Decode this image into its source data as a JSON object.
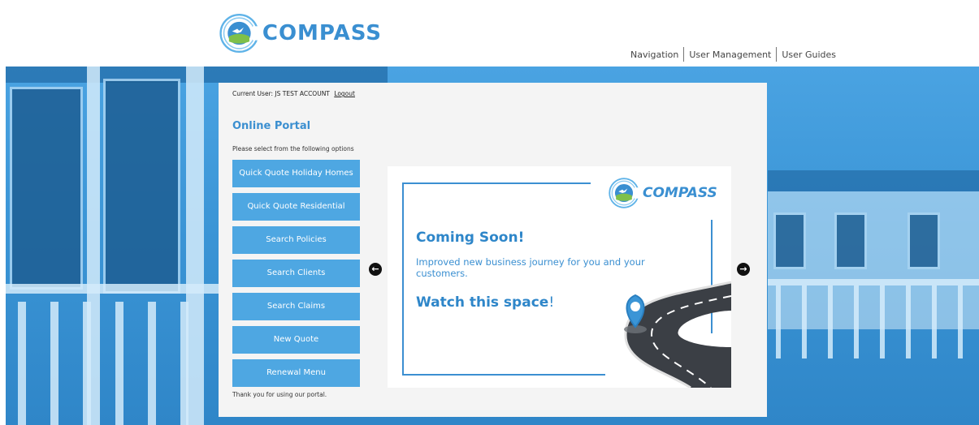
{
  "header": {
    "brand": "COMPASS",
    "nav": [
      "Navigation",
      "User Management",
      "User Guides"
    ]
  },
  "panel": {
    "current_user_label": "Current User: JS TEST ACCOUNT",
    "logout_label": "Logout",
    "title": "Online Portal",
    "subtitle": "Please select from the following options",
    "menu": [
      "Quick Quote Holiday Homes",
      "Quick Quote Residential",
      "Search Policies",
      "Search Clients",
      "Search Claims",
      "New Quote",
      "Renewal Menu"
    ],
    "thanks": "Thank you for using our portal."
  },
  "carousel": {
    "prev_icon": "arrow-left-icon",
    "next_icon": "arrow-right-icon",
    "slide": {
      "brand": "COMPASS",
      "heading": "Coming Soon!",
      "body": "Improved new business journey for you and your customers.",
      "footer_bold": "Watch this space",
      "footer_punct": "!"
    }
  },
  "colors": {
    "accent": "#3b8fd0",
    "button": "#4ea7e2",
    "background_blue": "#3b95d6"
  }
}
